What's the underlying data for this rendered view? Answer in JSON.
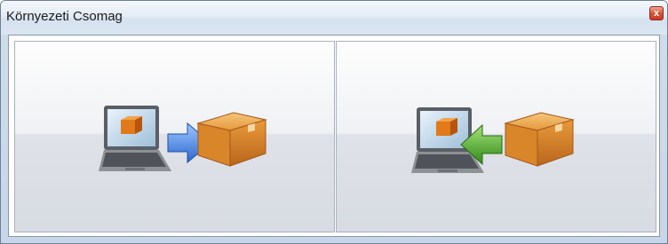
{
  "window": {
    "title": "Környezeti Csomag",
    "close_glyph": "x"
  },
  "panels": [
    {
      "icon": "laptop-export-to-package-icon",
      "arrow_color": "#3a7ad8",
      "arrow_direction": "right"
    },
    {
      "icon": "package-import-to-laptop-icon",
      "arrow_color": "#4aa82a",
      "arrow_direction": "left"
    }
  ]
}
